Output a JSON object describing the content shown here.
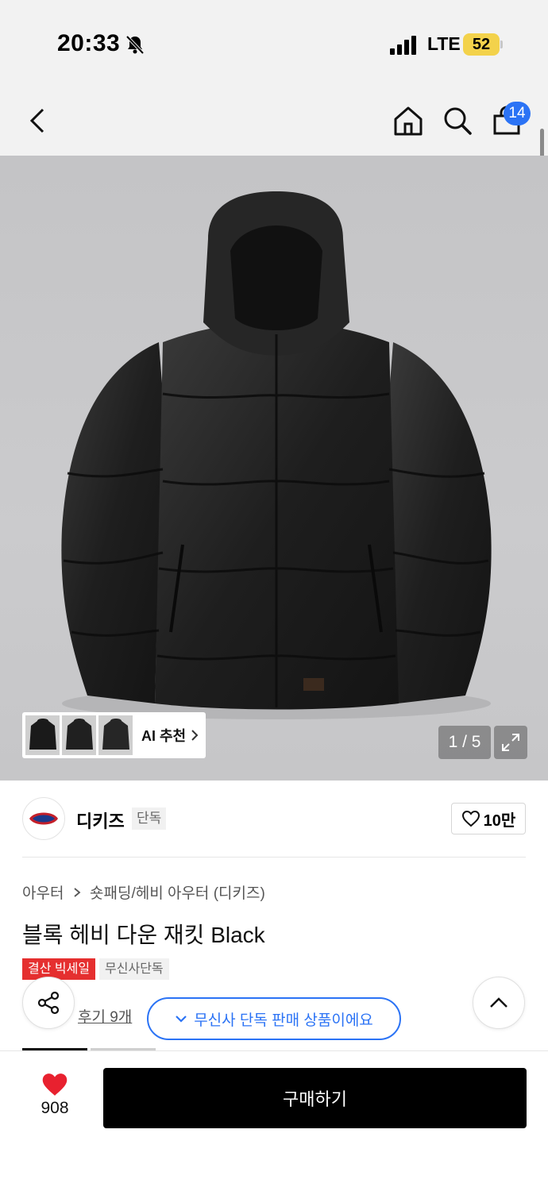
{
  "status": {
    "time": "20:33",
    "network": "LTE",
    "battery": "52"
  },
  "header": {
    "cart_count": "14",
    "icons": [
      "back-icon",
      "home-icon",
      "search-icon",
      "bag-icon"
    ]
  },
  "gallery": {
    "ai_label": "AI 추천",
    "counter": "1 / 5"
  },
  "brand": {
    "name": "디키즈",
    "tag": "단독",
    "likes": "10만"
  },
  "breadcrumb": {
    "items": [
      "아우터",
      "숏패딩/헤비 아우터 (디키즈)"
    ]
  },
  "product": {
    "title": "블록 헤비 다운 재킷 Black"
  },
  "badges": {
    "sale": "결산 빅세일",
    "exclusive": "무신사단독"
  },
  "reviews": {
    "label": "후기 9개"
  },
  "notice": {
    "exclusive_banner": "무신사 단독 판매 상품이에요"
  },
  "bottom": {
    "wish_count": "908",
    "buy_label": "구매하기"
  },
  "colors": {
    "accent_blue": "#2b73f5",
    "sale_red": "#e52f2f",
    "heart_red": "#e8212f",
    "battery_yellow": "#f3d24b"
  }
}
